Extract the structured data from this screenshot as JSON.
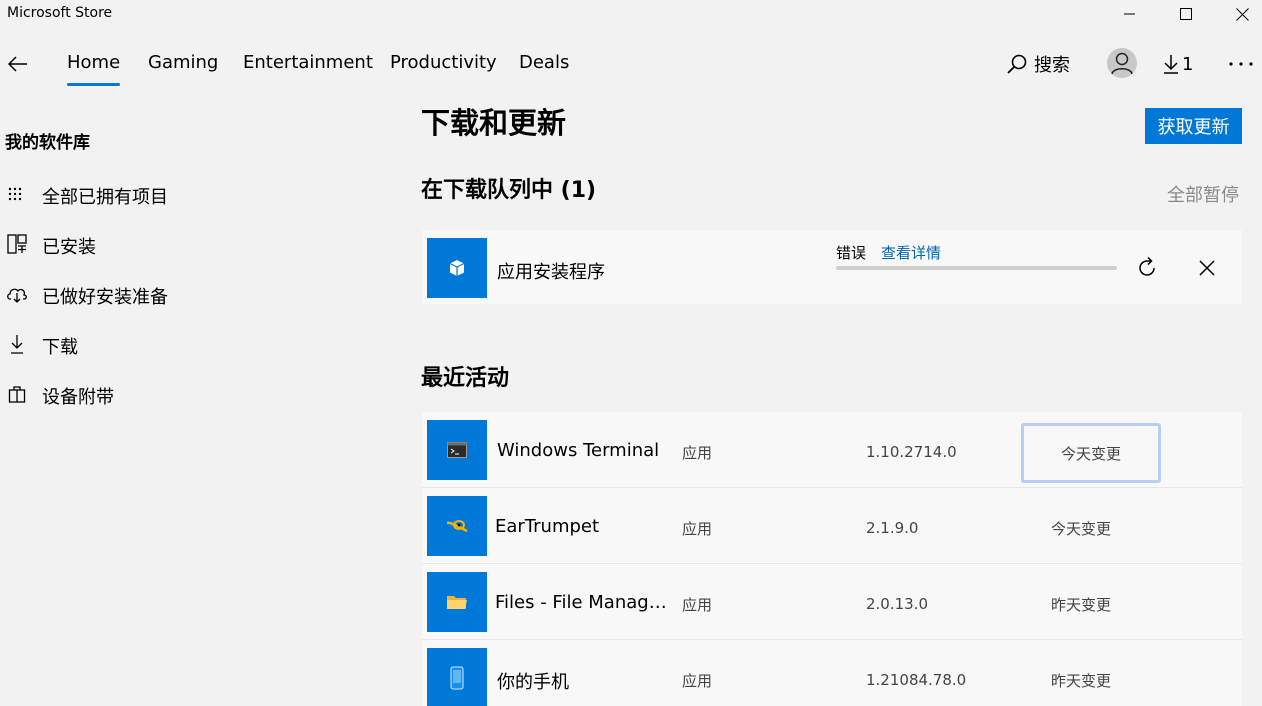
{
  "window": {
    "title": "Microsoft Store"
  },
  "nav": {
    "tabs": [
      {
        "label": "Home",
        "active": true
      },
      {
        "label": "Gaming",
        "active": false
      },
      {
        "label": "Entertainment",
        "active": false
      },
      {
        "label": "Productivity",
        "active": false
      },
      {
        "label": "Deals",
        "active": false
      }
    ],
    "search_label": "搜索",
    "downloads_count": "1"
  },
  "sidebar": {
    "title": "我的软件库",
    "items": [
      {
        "label": "全部已拥有项目",
        "icon": "grid-dots-icon"
      },
      {
        "label": "已安装",
        "icon": "installed-apps-icon"
      },
      {
        "label": "已做好安装准备",
        "icon": "cloud-download-icon"
      },
      {
        "label": "下载",
        "icon": "download-icon"
      },
      {
        "label": "设备附带",
        "icon": "gift-box-icon"
      }
    ]
  },
  "main": {
    "title": "下载和更新",
    "get_updates_label": "获取更新",
    "queue": {
      "title": "在下载队列中 (1)",
      "pause_all_label": "全部暂停",
      "items": [
        {
          "name": "应用安装程序",
          "icon": "package-icon",
          "status": "错误",
          "details_link": "查看详情",
          "progress": 0
        }
      ]
    },
    "recent": {
      "title": "最近活动",
      "rows": [
        {
          "name": "Windows Terminal",
          "type": "应用",
          "version": "1.10.2714.0",
          "status": "今天变更",
          "icon": "terminal-icon"
        },
        {
          "name": "EarTrumpet",
          "type": "应用",
          "version": "2.1.9.0",
          "status": "今天变更",
          "icon": "trumpet-icon"
        },
        {
          "name": "Files - File Manager...",
          "type": "应用",
          "version": "2.0.13.0",
          "status": "昨天变更",
          "icon": "folder-icon"
        },
        {
          "name": "你的手机",
          "type": "应用",
          "version": "1.21084.78.0",
          "status": "昨天变更",
          "icon": "phone-icon"
        }
      ]
    }
  },
  "colors": {
    "accent": "#0078d7",
    "link": "#0063b1",
    "background": "#f2f2f2",
    "card": "#f8f8f8"
  }
}
